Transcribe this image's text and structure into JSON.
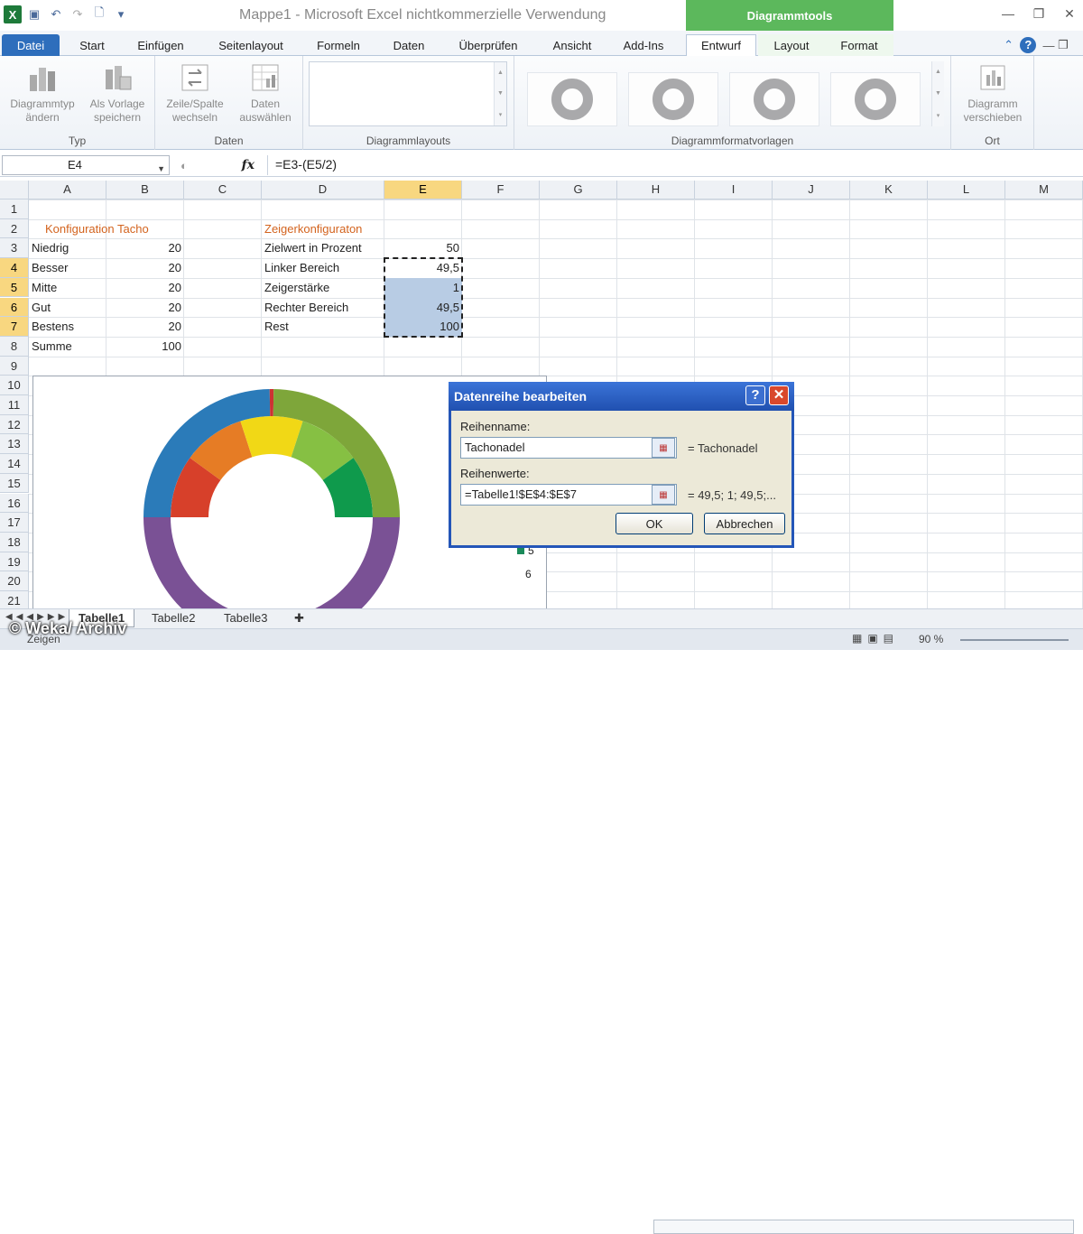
{
  "window": {
    "title": "Mappe1  -  Microsoft Excel nichtkommerzielle Verwendung",
    "context_tools": "Diagrammtools"
  },
  "tabs": [
    {
      "label": "Datei"
    },
    {
      "label": "Start"
    },
    {
      "label": "Einfügen"
    },
    {
      "label": "Seitenlayout"
    },
    {
      "label": "Formeln"
    },
    {
      "label": "Daten"
    },
    {
      "label": "Überprüfen"
    },
    {
      "label": "Ansicht"
    },
    {
      "label": "Add-Ins"
    },
    {
      "label": "Entwurf"
    },
    {
      "label": "Layout"
    },
    {
      "label": "Format"
    }
  ],
  "ribbon": {
    "typ": {
      "name": "Typ",
      "btn1": "Diagrammtyp ändern",
      "btn1a": "Diagrammtyp",
      "btn1b": "ändern",
      "btn2a": "Als Vorlage",
      "btn2b": "speichern"
    },
    "daten": {
      "name": "Daten",
      "btn1a": "Zeile/Spalte",
      "btn1b": "wechseln",
      "btn2a": "Daten",
      "btn2b": "auswählen"
    },
    "layouts": {
      "name": "Diagrammlayouts"
    },
    "formats": {
      "name": "Diagrammformatvorlagen"
    },
    "ort": {
      "name": "Ort",
      "btn1a": "Diagramm",
      "btn1b": "verschieben"
    }
  },
  "formula_bar": {
    "name_box": "E4",
    "fx": "fx",
    "formula": "=E3-(E5/2)"
  },
  "columns": [
    "A",
    "B",
    "C",
    "D",
    "E",
    "F",
    "G",
    "H",
    "I",
    "J",
    "K",
    "L",
    "M"
  ],
  "rows": [
    "1",
    "2",
    "3",
    "4",
    "5",
    "6",
    "7",
    "8",
    "9",
    "10",
    "11",
    "12",
    "13",
    "14",
    "15",
    "16",
    "17",
    "18",
    "19",
    "20",
    "21"
  ],
  "cells": {
    "A2": "Konfiguration Tacho",
    "A3": "Niedrig",
    "B3": "20",
    "A4": "Besser",
    "B4": "20",
    "A5": "Mitte",
    "B5": "20",
    "A6": "Gut",
    "B6": "20",
    "A7": "Bestens",
    "B7": "20",
    "A8": "Summe",
    "B8": "100",
    "D2": "Zeigerkonfiguraton",
    "D3": "Zielwert in Prozent",
    "E3": "50",
    "D4": "Linker Bereich",
    "E4": "49,5",
    "D5": "Zeigerstärke",
    "E5": "1",
    "D6": "Rechter Bereich",
    "E6": "49,5",
    "D7": "Rest",
    "E7": "100"
  },
  "chart_data": {
    "type": "donut",
    "series": [
      {
        "values": [
          20,
          20,
          20,
          20,
          20,
          100
        ],
        "colors": [
          "#d7402a",
          "#e67c25",
          "#f1d816",
          "#86c043",
          "#0f9a4c",
          "#ffffff"
        ]
      },
      {
        "values": [
          49.5,
          1,
          49.5,
          100
        ],
        "colors": [
          "#2b7bb9",
          "#cc3333",
          "#7ea63a",
          "#7a5195"
        ]
      }
    ],
    "legend": [
      "5",
      "6"
    ]
  },
  "dialog": {
    "title": "Datenreihe bearbeiten",
    "help": "?",
    "close": "✕",
    "name_label": "Reihenname:",
    "name_value": "Tachonadel",
    "name_result": "= Tachonadel",
    "values_label": "Reihenwerte:",
    "values_value": "=Tabelle1!$E$4:$E$7",
    "values_result": "= 49,5; 1; 49,5;...",
    "ok": "OK",
    "cancel": "Abbrechen"
  },
  "sheets": [
    "Tabelle1",
    "Tabelle2",
    "Tabelle3"
  ],
  "status": {
    "zoom": "90 %",
    "left": "Zeigen"
  },
  "watermark": "© Weka/ Archiv"
}
